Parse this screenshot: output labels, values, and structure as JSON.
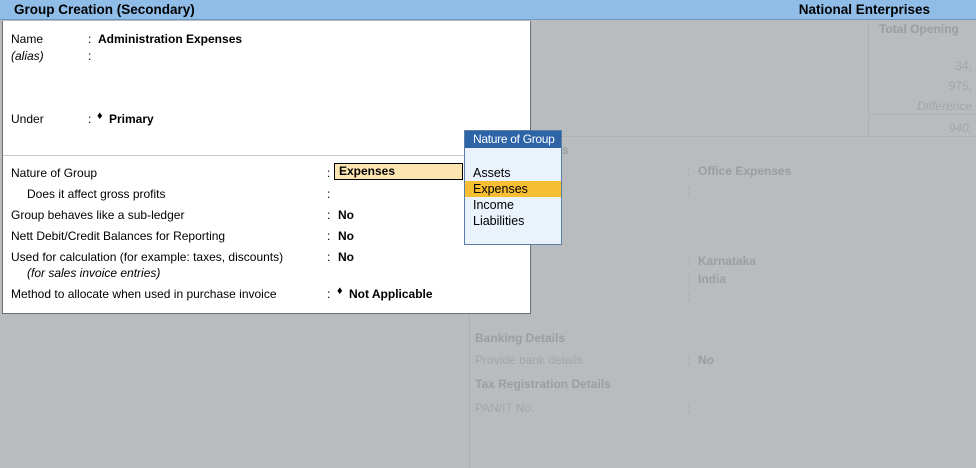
{
  "window": {
    "title": "Group Creation (Secondary)",
    "company": "National Enterprises"
  },
  "form": {
    "name_label": "Name",
    "name_value": "Administration Expenses",
    "alias_label": "(alias)",
    "under_label": "Under",
    "under_value": "Primary",
    "nature_label": "Nature of Group",
    "nature_value": "Expenses",
    "gross_label": "Does it affect gross profits",
    "subledger_label": "Group behaves like a sub-ledger",
    "subledger_value": "No",
    "nett_label": "Nett Debit/Credit Balances for Reporting",
    "nett_value": "No",
    "calc_label": "Used for calculation (for example: taxes, discounts)",
    "calc_sublabel": "(for sales invoice entries)",
    "calc_value": "No",
    "method_label": "Method to allocate when used in purchase invoice",
    "method_value": "Not Applicable",
    "colon": ":",
    "diamond": "♦"
  },
  "popup": {
    "title": "Nature of Group",
    "items": [
      "Assets",
      "Expenses",
      "Income",
      "Liabilities"
    ],
    "selected": "Expenses"
  },
  "background": {
    "col_header": "Total Opening",
    "val1": "34,",
    "val2": "975,",
    "difference": "Difference",
    "val3": "940,",
    "partial_s": "s",
    "office_expenses": "Office Expenses",
    "karnataka": "Karnataka",
    "india": "India",
    "banking_details": "Banking Details",
    "provide_bank": "Provide bank details",
    "provide_bank_value": "No",
    "tax_reg": "Tax Registration Details",
    "pan": "PAN/IT No."
  }
}
